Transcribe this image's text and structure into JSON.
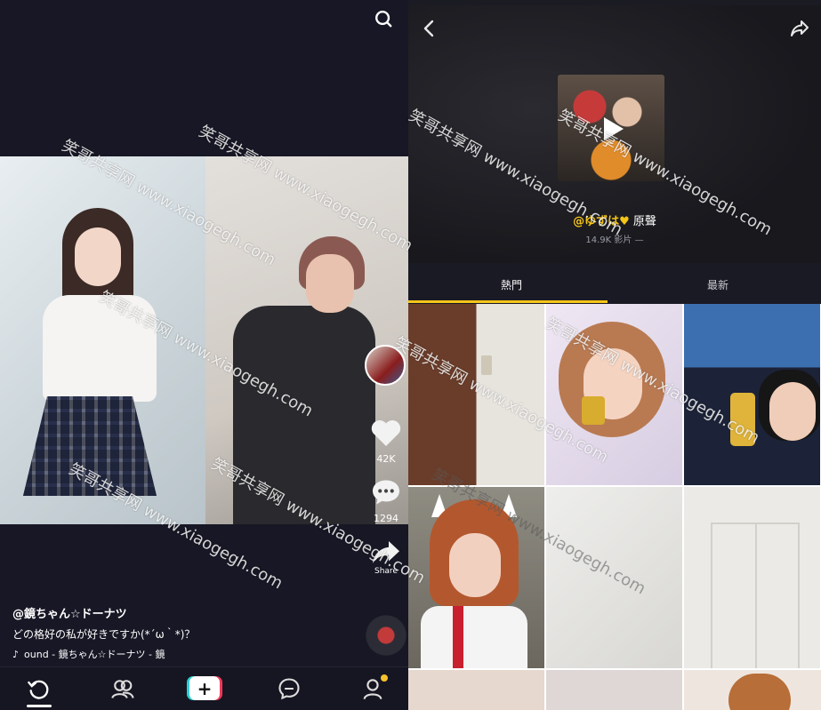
{
  "feed": {
    "likes": "42K",
    "comments": "1294",
    "share_label": "Share",
    "username": "@鏡ちゃん☆ドーナツ",
    "description": "どの格好の私が好きですか(*´ω｀*)？",
    "sound": "ound - 鏡ちゃん☆ドーナツ - 鏡"
  },
  "sound_page": {
    "name": "@ゆずは♥",
    "name_suffix": " 原聲",
    "videos_meta": "14.9K 影片 —",
    "tabs": [
      "熱門",
      "最新"
    ]
  },
  "watermark": {
    "site_cn": "笑哥共享网",
    "site_url": "www.xiaogegh.com"
  },
  "icons": [
    "search-icon",
    "heart-icon",
    "comment-icon",
    "share-icon",
    "back-icon",
    "share-arrow-icon",
    "home-icon",
    "friends-icon",
    "create-icon",
    "inbox-icon",
    "profile-icon",
    "tiktok-note-icon"
  ],
  "colors": {
    "accent": "#f5c518",
    "background": "#171725",
    "notification": "#f4c22c"
  }
}
